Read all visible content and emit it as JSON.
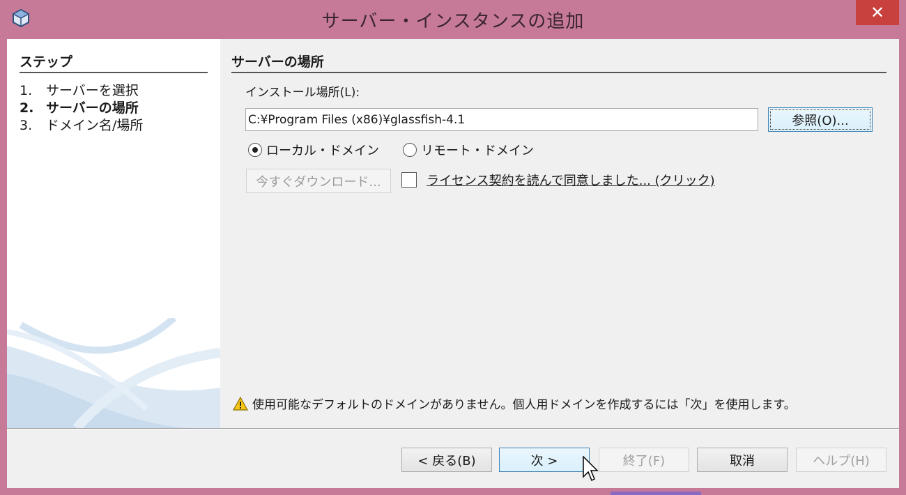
{
  "window": {
    "title": "サーバー・インスタンスの追加",
    "close_label": "✕"
  },
  "steps": {
    "title": "ステップ",
    "items": [
      {
        "num": "1.",
        "label": "サーバーを選択",
        "current": false
      },
      {
        "num": "2.",
        "label": "サーバーの場所",
        "current": true
      },
      {
        "num": "3.",
        "label": "ドメイン名/場所",
        "current": false
      }
    ]
  },
  "main": {
    "section_title": "サーバーの場所",
    "install_label": "インストール場所(L):",
    "install_path": "C:¥Program Files (x86)¥glassfish-4.1",
    "browse_label": "参照(O)...",
    "radio_local": {
      "label": "ローカル・ドメイン",
      "checked": true
    },
    "radio_remote": {
      "label": "リモート・ドメイン",
      "checked": false
    },
    "download_label": "今すぐダウンロード...",
    "license_label": "ライセンス契約を読んで同意しました... (クリック)",
    "license_checked": false,
    "warning": "使用可能なデフォルトのドメインがありません。個人用ドメインを作成するには「次」を使用します。"
  },
  "footer": {
    "back": "< 戻る(B)",
    "next": "次 >",
    "finish": "終了(F)",
    "cancel": "取消",
    "help": "ヘルプ(H)"
  },
  "colors": {
    "titlebar": "#c67a97",
    "close": "#c8413e",
    "accent_border": "#3c7fb1"
  }
}
